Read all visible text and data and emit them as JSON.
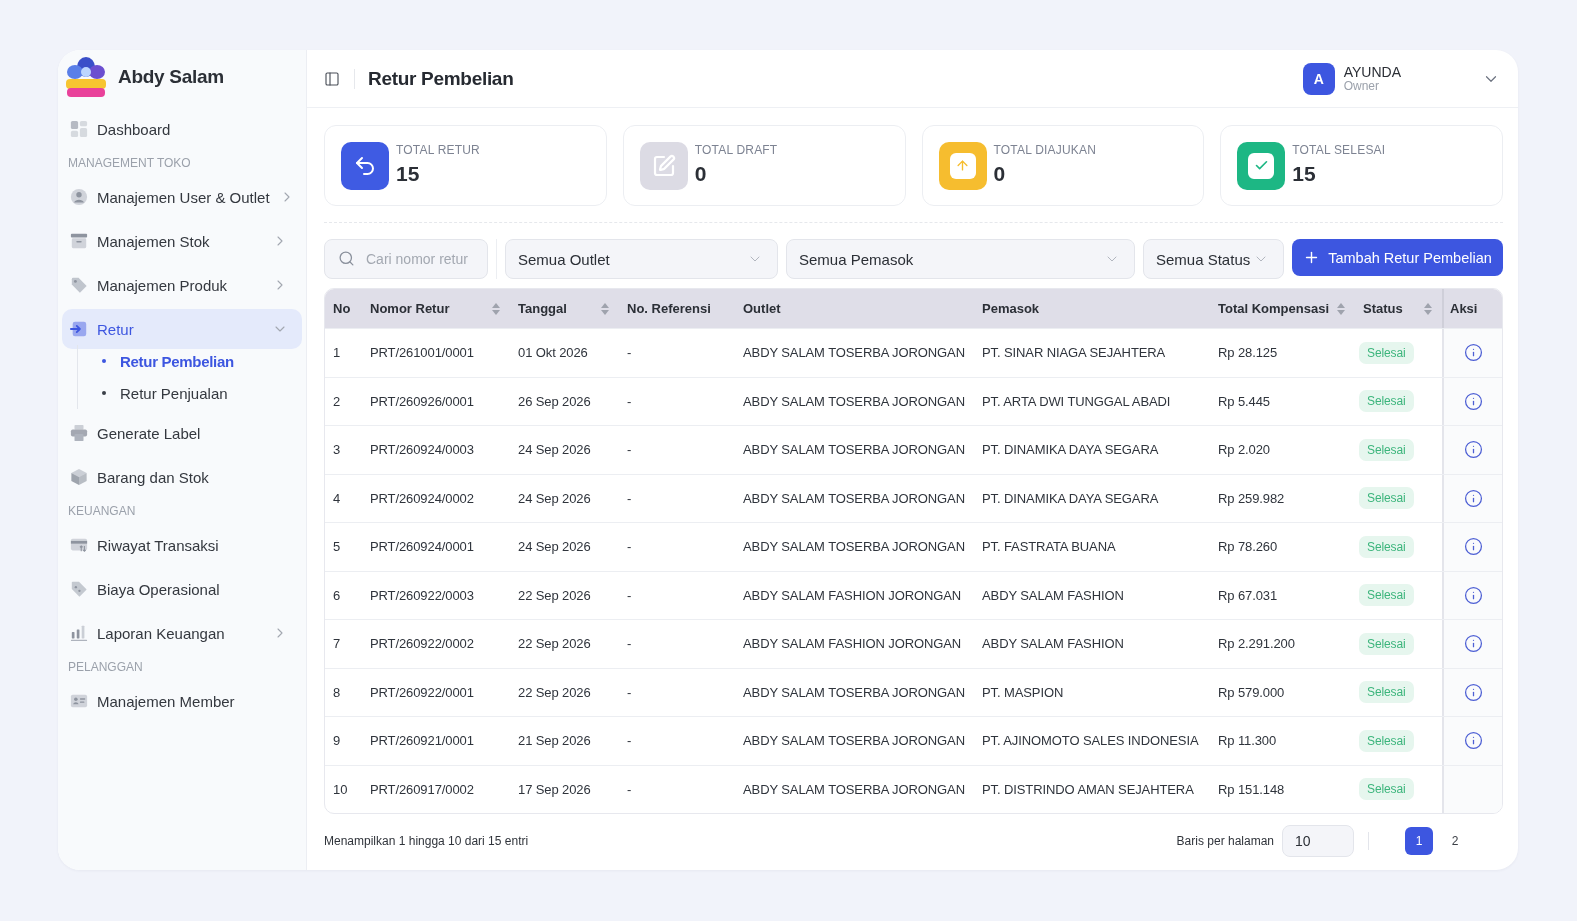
{
  "brand": {
    "name": "Abdy Salam"
  },
  "sidebar": {
    "sections": [
      {
        "items": [
          {
            "label": "Dashboard",
            "selected": false
          }
        ]
      },
      {
        "heading": "MANAGEMENT TOKO",
        "items": [
          {
            "label": "Manajemen User & Outlet",
            "selected": false,
            "expanded": false
          },
          {
            "label": "Manajemen Stok",
            "selected": false,
            "expanded": false
          },
          {
            "label": "Manajemen Produk",
            "selected": false,
            "expanded": false
          },
          {
            "label": "Retur",
            "selected": true,
            "expanded": true,
            "children": [
              {
                "label": "Retur Pembelian",
                "selected": true
              },
              {
                "label": "Retur Penjualan",
                "selected": false
              }
            ]
          },
          {
            "label": "Generate Label",
            "selected": false
          },
          {
            "label": "Barang dan Stok",
            "selected": false
          }
        ]
      },
      {
        "heading": "KEUANGAN",
        "items": [
          {
            "label": "Riwayat Transaksi",
            "selected": false
          },
          {
            "label": "Biaya Operasional",
            "selected": false
          },
          {
            "label": "Laporan Keuangan",
            "selected": false,
            "expanded": false
          }
        ]
      },
      {
        "heading": "PELANGGAN",
        "items": [
          {
            "label": "Manajemen Member",
            "selected": false
          }
        ]
      }
    ]
  },
  "header": {
    "title": "Retur Pembelian",
    "user": {
      "initial": "A",
      "name": "AYUNDA",
      "role": "Owner"
    }
  },
  "stats": [
    {
      "label": "TOTAL RETUR",
      "value": "15",
      "color": "#3f5be3"
    },
    {
      "label": "TOTAL DRAFT",
      "value": "0",
      "color": "#dcdbe4"
    },
    {
      "label": "TOTAL DIAJUKAN",
      "value": "0",
      "color": "#f6bd2f"
    },
    {
      "label": "TOTAL SELESAI",
      "value": "15",
      "color": "#1db784"
    }
  ],
  "filters": {
    "search": {
      "placeholder": "Cari nomor retur"
    },
    "dropdowns": [
      {
        "value": "Semua Outlet"
      },
      {
        "value": "Semua Pemasok"
      },
      {
        "value": "Semua Status"
      }
    ],
    "add_button": {
      "label": "Tambah Retur Pembelian"
    }
  },
  "table": {
    "columns": [
      {
        "label": "No",
        "sortable": false
      },
      {
        "label": "Nomor Retur",
        "sortable": true
      },
      {
        "label": "Tanggal",
        "sortable": true
      },
      {
        "label": "No. Referensi",
        "sortable": false
      },
      {
        "label": "Outlet",
        "sortable": false
      },
      {
        "label": "Pemasok",
        "sortable": false
      },
      {
        "label": "Total Kompensasi",
        "sortable": true
      },
      {
        "label": "Status",
        "sortable": true
      },
      {
        "label": "Aksi",
        "sortable": false
      }
    ],
    "rows": [
      {
        "no": "1",
        "number": "PRT/261001/0001",
        "date": "01 Okt 2026",
        "reference": "-",
        "outlet": "ABDY SALAM TOSERBA JORONGAN",
        "supplier": "PT. SINAR NIAGA SEJAHTERA",
        "compensation": "Rp 28.125",
        "status": "Selesai",
        "detail_action": true
      },
      {
        "no": "2",
        "number": "PRT/260926/0001",
        "date": "26 Sep 2026",
        "reference": "-",
        "outlet": "ABDY SALAM TOSERBA JORONGAN",
        "supplier": "PT. ARTA DWI TUNGGAL ABADI",
        "compensation": "Rp 5.445",
        "status": "Selesai",
        "detail_action": true
      },
      {
        "no": "3",
        "number": "PRT/260924/0003",
        "date": "24 Sep 2026",
        "reference": "-",
        "outlet": "ABDY SALAM TOSERBA JORONGAN",
        "supplier": "PT. DINAMIKA DAYA SEGARA",
        "compensation": "Rp 2.020",
        "status": "Selesai",
        "detail_action": true
      },
      {
        "no": "4",
        "number": "PRT/260924/0002",
        "date": "24 Sep 2026",
        "reference": "-",
        "outlet": "ABDY SALAM TOSERBA JORONGAN",
        "supplier": "PT. DINAMIKA DAYA SEGARA",
        "compensation": "Rp 259.982",
        "status": "Selesai",
        "detail_action": true
      },
      {
        "no": "5",
        "number": "PRT/260924/0001",
        "date": "24 Sep 2026",
        "reference": "-",
        "outlet": "ABDY SALAM TOSERBA JORONGAN",
        "supplier": "PT. FASTRATA BUANA",
        "compensation": "Rp 78.260",
        "status": "Selesai",
        "detail_action": true
      },
      {
        "no": "6",
        "number": "PRT/260922/0003",
        "date": "22 Sep 2026",
        "reference": "-",
        "outlet": "ABDY SALAM FASHION JORONGAN",
        "supplier": "ABDY SALAM FASHION",
        "compensation": "Rp 67.031",
        "status": "Selesai",
        "detail_action": true
      },
      {
        "no": "7",
        "number": "PRT/260922/0002",
        "date": "22 Sep 2026",
        "reference": "-",
        "outlet": "ABDY SALAM FASHION JORONGAN",
        "supplier": "ABDY SALAM FASHION",
        "compensation": "Rp 2.291.200",
        "status": "Selesai",
        "detail_action": true
      },
      {
        "no": "8",
        "number": "PRT/260922/0001",
        "date": "22 Sep 2026",
        "reference": "-",
        "outlet": "ABDY SALAM TOSERBA JORONGAN",
        "supplier": "PT. MASPION",
        "compensation": "Rp 579.000",
        "status": "Selesai",
        "detail_action": true
      },
      {
        "no": "9",
        "number": "PRT/260921/0001",
        "date": "21 Sep 2026",
        "reference": "-",
        "outlet": "ABDY SALAM TOSERBA JORONGAN",
        "supplier": "PT. AJINOMOTO SALES INDONESIA",
        "compensation": "Rp 11.300",
        "status": "Selesai",
        "detail_action": true
      },
      {
        "no": "10",
        "number": "PRT/260917/0002",
        "date": "17 Sep 2026",
        "reference": "-",
        "outlet": "ABDY SALAM TOSERBA JORONGAN",
        "supplier": "PT. DISTRINDO AMAN SEJAHTERA",
        "compensation": "Rp 151.148",
        "status": "Selesai",
        "detail_action": false
      }
    ]
  },
  "footer": {
    "summary": "Menampilkan 1 hingga 10 dari 15 entri",
    "rows_per_page": {
      "label": "Baris per halaman",
      "value": "10"
    },
    "pages": [
      {
        "label": "1",
        "selected": true
      },
      {
        "label": "2",
        "selected": false
      }
    ]
  }
}
